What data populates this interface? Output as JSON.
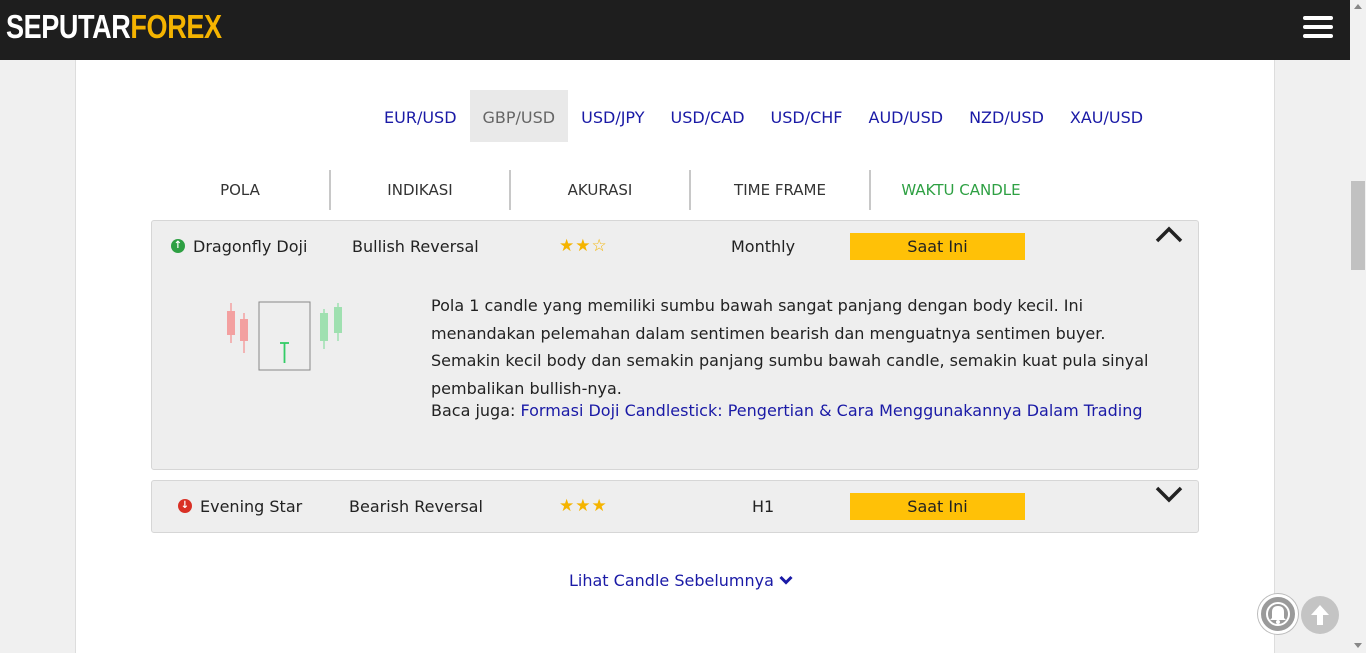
{
  "header": {
    "logo_part1": "SEPUTAR",
    "logo_part2": "FOREX",
    "menu_icon": "hamburger-menu-icon",
    "colors": {
      "bar": "#1e1e1e",
      "logo_accent": "#f5b400"
    }
  },
  "pairs": [
    "EUR/USD",
    "GBP/USD",
    "USD/JPY",
    "USD/CAD",
    "USD/CHF",
    "AUD/USD",
    "NZD/USD",
    "XAU/USD"
  ],
  "active_pair": "GBP/USD",
  "columns": [
    "POLA",
    "INDIKASI",
    "AKURASI",
    "TIME FRAME",
    "WAKTU CANDLE"
  ],
  "patterns": [
    {
      "direction_icon": "arrow-up-circle-icon",
      "name": "Dragonfly Doji",
      "indication": "Bullish Reversal",
      "stars_display": "★★☆",
      "accuracy_rating": "2 of 3",
      "timeframe": "Monthly",
      "candle_time": "Saat Ini",
      "expanded": true,
      "toggle_icon": "chevron-up-icon",
      "description": "Pola 1 candle yang memiliki sumbu bawah sangat panjang dengan body kecil. Ini menandakan pelemahan dalam sentimen bearish dan menguatnya sentimen buyer. Semakin kecil body dan semakin panjang sumbu bawah candle, semakin kuat pula sinyal pembalikan bullish-nya.",
      "read_also_label": "Baca juga: ",
      "read_also_link": "Formasi Doji Candlestick: Pengertian & Cara Menggunakannya Dalam Trading"
    },
    {
      "direction_icon": "arrow-down-circle-icon",
      "name": "Evening Star",
      "indication": "Bearish Reversal",
      "stars_display": "★★★",
      "accuracy_rating": "3 of 3",
      "timeframe": "H1",
      "candle_time": "Saat Ini",
      "expanded": false,
      "toggle_icon": "chevron-down-icon"
    }
  ],
  "load_more": {
    "label": "Lihat Candle Sebelumnya",
    "icon": "chevron-down-icon"
  },
  "floating": {
    "notification_icon": "bell-icon",
    "scroll_top_icon": "arrow-up-icon"
  },
  "colors": {
    "link": "#1a1aa6",
    "bullish": "#2ea043",
    "bearish": "#d93025",
    "badge": "#ffc107",
    "stars": "#f5b400"
  }
}
